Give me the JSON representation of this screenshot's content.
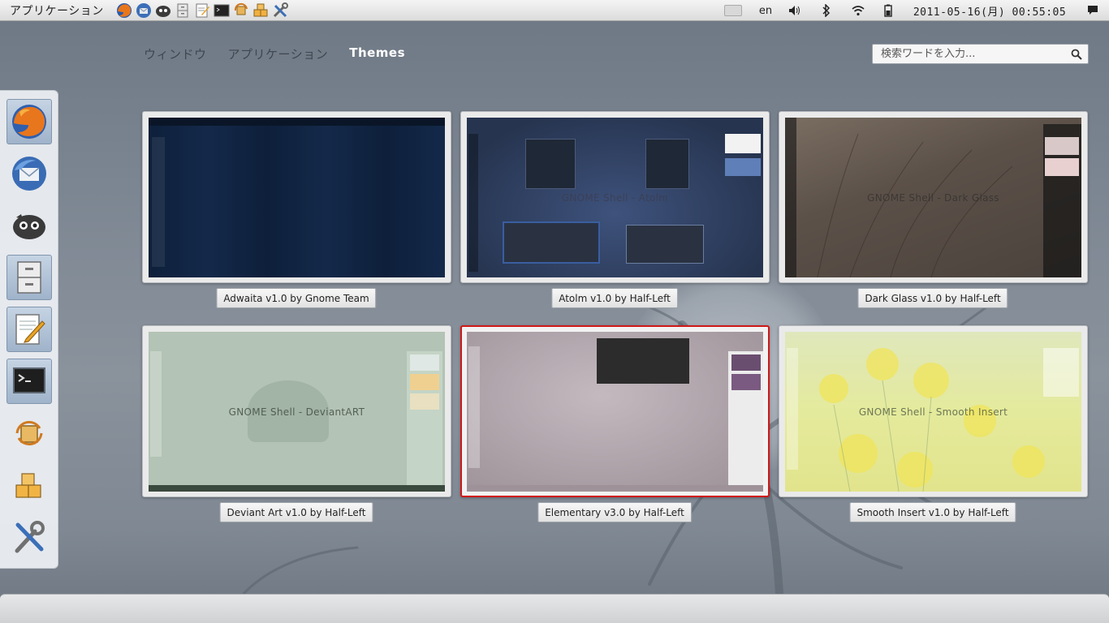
{
  "top_panel": {
    "applications_menu": "アプリケーション",
    "launchers": [
      "firefox-icon",
      "thunderbird-icon",
      "pidgin-icon",
      "file-cabinet-icon",
      "text-editor-icon",
      "terminal-icon",
      "update-manager-icon",
      "package-installer-icon",
      "system-tools-icon"
    ],
    "keyboard_layout": "en",
    "clock": "2011-05-16(月) 00:55:05"
  },
  "tabs": [
    {
      "label": "ウィンドウ",
      "active": false
    },
    {
      "label": "アプリケーション",
      "active": false
    },
    {
      "label": "Themes",
      "active": true
    }
  ],
  "search": {
    "placeholder": "検索ワードを入力..."
  },
  "dash": {
    "items": [
      {
        "icon": "firefox-icon",
        "running": true
      },
      {
        "icon": "thunderbird-icon",
        "running": false
      },
      {
        "icon": "pidgin-icon",
        "running": false
      },
      {
        "icon": "file-cabinet-icon",
        "running": true
      },
      {
        "icon": "text-editor-icon",
        "running": true
      },
      {
        "icon": "terminal-icon",
        "running": true
      },
      {
        "icon": "update-manager-icon",
        "running": false
      },
      {
        "icon": "package-installer-icon",
        "running": false
      },
      {
        "icon": "system-tools-icon",
        "running": false
      }
    ]
  },
  "themes": [
    {
      "caption": "Adwaita v1.0 by Gnome Team",
      "thumb_text": "",
      "selected": false,
      "colors": [
        "#102440",
        "#0a1a33"
      ]
    },
    {
      "caption": "Atolm v1.0 by Half-Left",
      "thumb_text": "GNOME Shell - Atolm",
      "selected": false,
      "colors": [
        "#3a4e78",
        "#22304f"
      ]
    },
    {
      "caption": "Dark Glass v1.0 by Half-Left",
      "thumb_text": "GNOME Shell - Dark Glass",
      "selected": false,
      "colors": [
        "#6e6258",
        "#3e3834"
      ]
    },
    {
      "caption": "Deviant Art v1.0 by Half-Left",
      "thumb_text": "GNOME Shell - DeviantART",
      "selected": false,
      "colors": [
        "#b4c4b6",
        "#a3b3a6"
      ]
    },
    {
      "caption": "Elementary v3.0 by Half-Left",
      "thumb_text": "",
      "selected": true,
      "colors": [
        "#b9aeb4",
        "#a79aa1"
      ]
    },
    {
      "caption": "Smooth Insert v1.0 by Half-Left",
      "thumb_text": "GNOME Shell - Smooth Insert",
      "selected": false,
      "colors": [
        "#dfe8b2",
        "#c9dba6"
      ]
    }
  ],
  "accent": {
    "selected_border": "#d01818",
    "active_tab": "#ffffff"
  }
}
